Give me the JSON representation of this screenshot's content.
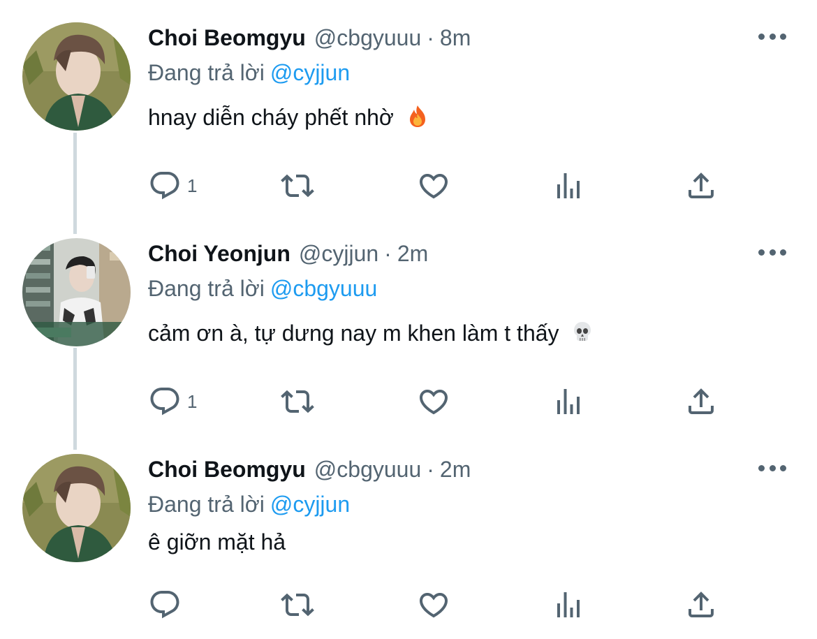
{
  "tweets": [
    {
      "name": "Choi Beomgyu",
      "handle": "@cbgyuuu",
      "separator": "·",
      "time": "8m",
      "reply_prefix": "Đang trả lời",
      "reply_to": "@cyjjun",
      "text": "hnay diễn cháy phết nhờ",
      "emoji": "fire-emoji",
      "reply_count": "1"
    },
    {
      "name": "Choi Yeonjun",
      "handle": "@cyjjun",
      "separator": "·",
      "time": "2m",
      "reply_prefix": "Đang trả lời",
      "reply_to": "@cbgyuuu",
      "text": "cảm ơn à, tự dưng nay m khen làm t thấy",
      "emoji": "skull-emoji",
      "reply_count": "1"
    },
    {
      "name": "Choi Beomgyu",
      "handle": "@cbgyuuu",
      "separator": "·",
      "time": "2m",
      "reply_prefix": "Đang trả lời",
      "reply_to": "@cyjjun",
      "text": "ê giỡn mặt hả",
      "emoji": "",
      "reply_count": ""
    }
  ],
  "icons": {
    "reply": "reply-icon",
    "retweet": "retweet-icon",
    "like": "heart-icon",
    "views": "views-icon",
    "share": "share-icon",
    "more": "more-icon"
  },
  "colors": {
    "text": "#0f1419",
    "secondary": "#536471",
    "link": "#1d9bf0",
    "thread_line": "#cfd9de"
  }
}
